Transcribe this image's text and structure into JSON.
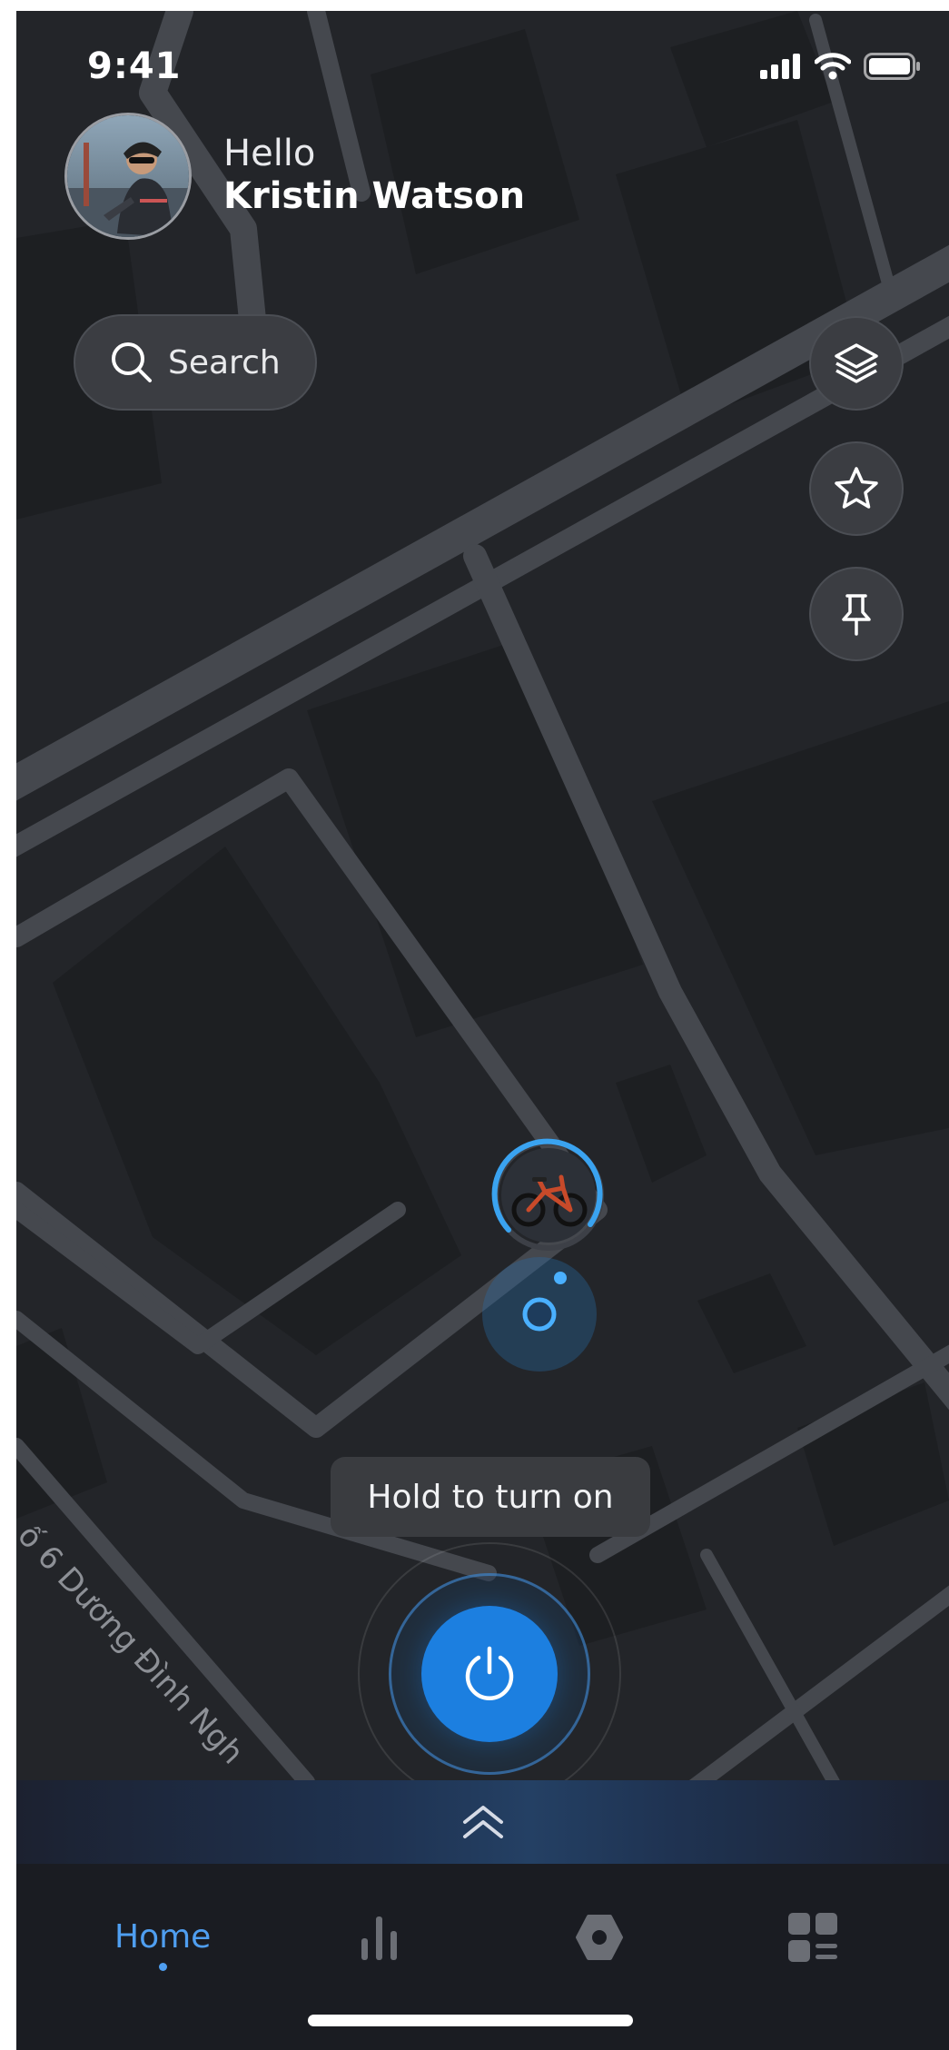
{
  "status": {
    "time": "9:41"
  },
  "user": {
    "greeting": "Hello",
    "name": "Kristin Watson"
  },
  "search": {
    "label": "Search"
  },
  "map": {
    "street_label": "ố 6 Dương Đình Ngh"
  },
  "fabs": [
    "layers-icon",
    "star-icon",
    "pin-icon"
  ],
  "power": {
    "hint": "Hold to turn on"
  },
  "tabs": {
    "home": "Home",
    "stats": "bar-chart-icon",
    "device": "hexagon-icon",
    "menu": "grid-icon"
  },
  "colors": {
    "accent": "#1c7fe0",
    "active_tab": "#4f9ef0",
    "background": "#232529"
  }
}
